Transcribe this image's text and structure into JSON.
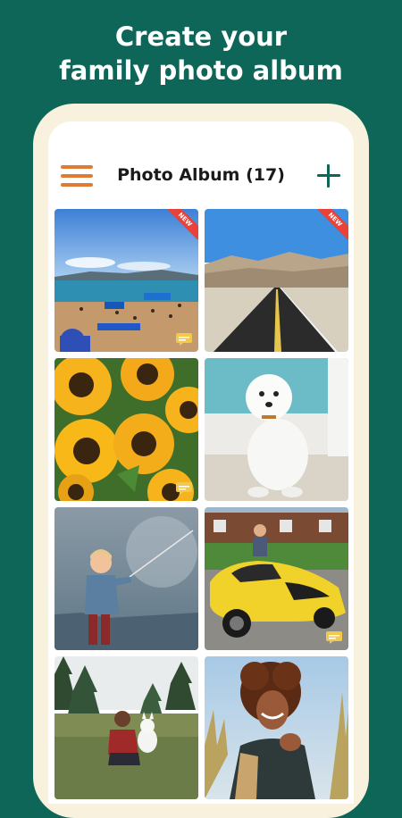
{
  "hero": {
    "line1": "Create your",
    "line2": "family photo album"
  },
  "appbar": {
    "title": "Photo Album (17)",
    "menu_icon": "hamburger-menu-icon",
    "add_icon": "plus-icon"
  },
  "colors": {
    "background": "#0e6659",
    "accent_orange": "#e07b33",
    "new_badge": "#e8433a",
    "comment_badge": "#f2c94c"
  },
  "photos": [
    {
      "subject": "beach",
      "badge": "NEW",
      "has_comment": true
    },
    {
      "subject": "desert-road",
      "badge": "NEW",
      "has_comment": false
    },
    {
      "subject": "sunflowers",
      "badge": "",
      "has_comment": true
    },
    {
      "subject": "white-dog",
      "badge": "",
      "has_comment": false
    },
    {
      "subject": "child-fishing",
      "badge": "",
      "has_comment": false
    },
    {
      "subject": "yellow-sports-car",
      "badge": "",
      "has_comment": true
    },
    {
      "subject": "woman-with-dog",
      "badge": "",
      "has_comment": false
    },
    {
      "subject": "smiling-woman",
      "badge": "",
      "has_comment": false
    }
  ]
}
